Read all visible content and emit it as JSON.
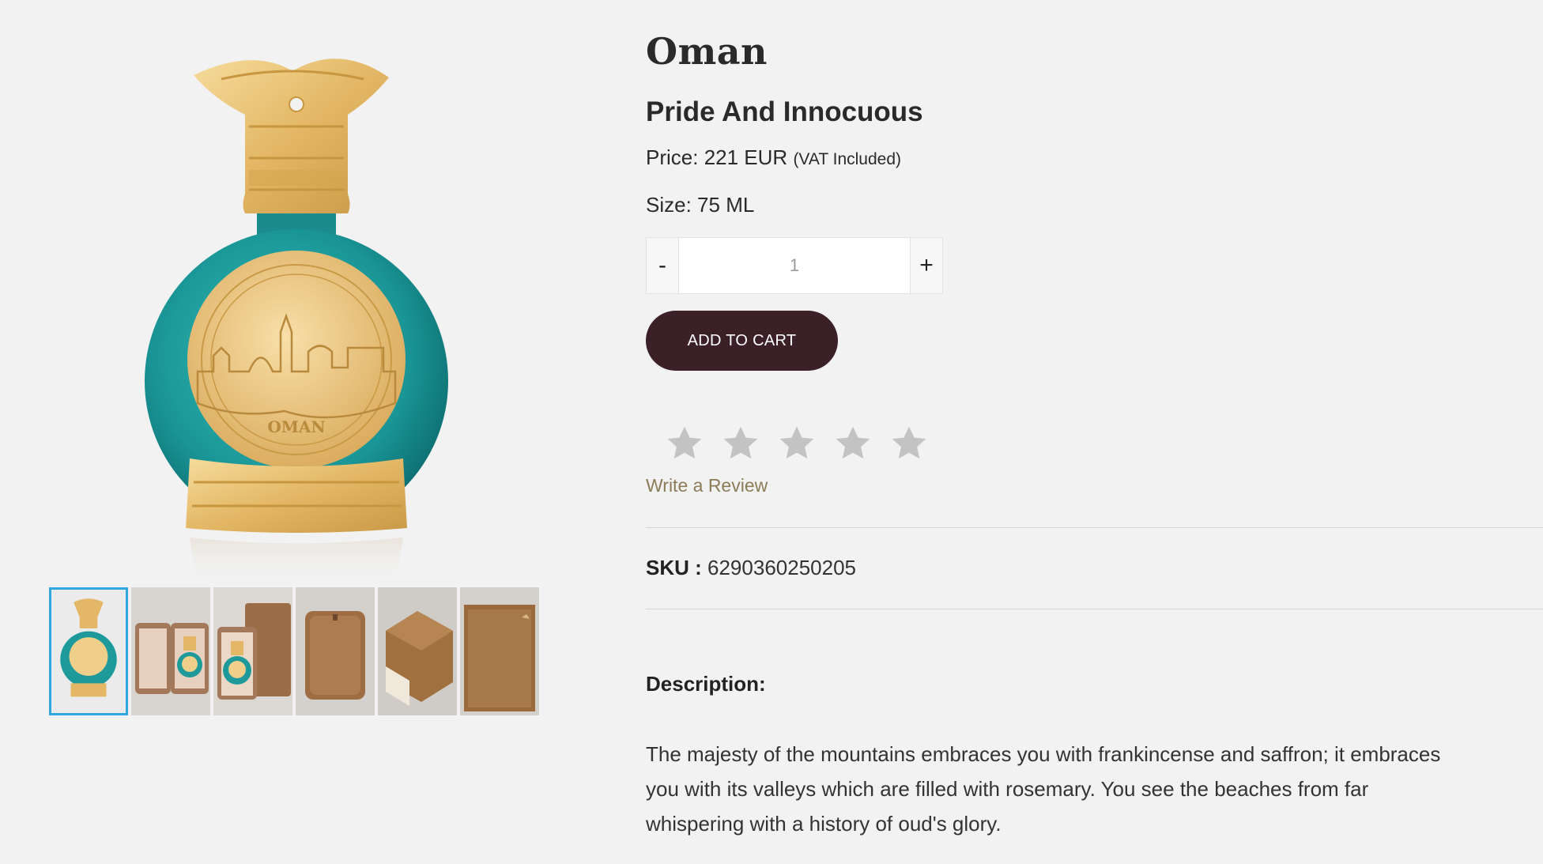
{
  "product": {
    "title": "Oman",
    "subtitle": "Pride And Innocuous",
    "price_label": "Price:",
    "price_value": "221 EUR",
    "vat_note": "(VAT Included)",
    "size_label": "Size:",
    "size_value": "75 ML",
    "sku_label": "SKU :",
    "sku_value": "6290360250205",
    "bottle_engraving": "OMAN"
  },
  "quantity": {
    "minus_label": "-",
    "value": "1",
    "plus_label": "+"
  },
  "cart": {
    "add_label": "ADD TO CART"
  },
  "rating": {
    "stars_total": 5,
    "stars_filled": 0,
    "write_review_label": "Write a Review"
  },
  "description": {
    "heading": "Description:",
    "text": "The majesty of the mountains embraces you with frankincense and saffron; it embraces you with its valleys which are filled with rosemary. You see the beaches from far whispering with a history of oud's glory."
  },
  "gallery": {
    "thumbnails": [
      {
        "icon": "bottle-front-icon",
        "active": true
      },
      {
        "icon": "open-case-icon",
        "active": false
      },
      {
        "icon": "case-with-bottle-icon",
        "active": false
      },
      {
        "icon": "closed-case-icon",
        "active": false
      },
      {
        "icon": "drawer-box-icon",
        "active": false
      },
      {
        "icon": "box-front-icon",
        "active": false
      }
    ]
  },
  "colors": {
    "bottle_teal": "#1e9a9b",
    "gold": "#e8be6a",
    "cart_button": "#3c2028",
    "review_link": "#8c7c57",
    "star_empty": "#c3c3c3",
    "thumb_active_border": "#2ea6e0"
  }
}
